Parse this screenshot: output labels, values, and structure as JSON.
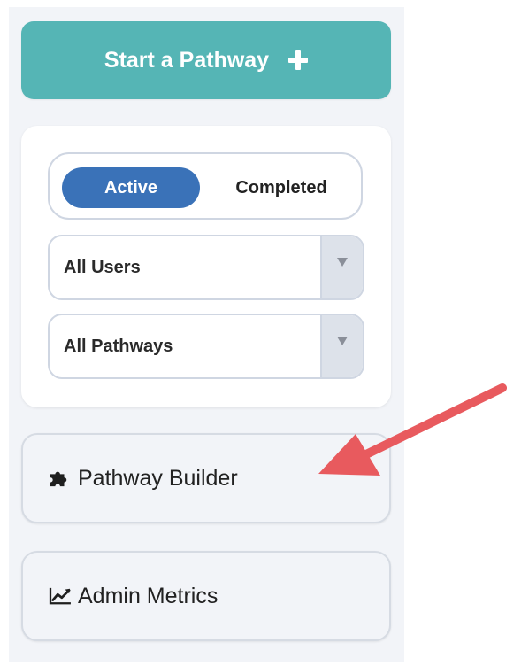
{
  "start_button": {
    "label": "Start a Pathway",
    "icon": "plus-icon"
  },
  "status_toggle": {
    "options": [
      "Active",
      "Completed"
    ],
    "selected": "Active"
  },
  "filters": {
    "users": {
      "value": "All Users"
    },
    "pathways": {
      "value": "All Pathways"
    }
  },
  "nav": {
    "pathway_builder": {
      "label": "Pathway Builder",
      "icon": "puzzle-piece-icon"
    },
    "admin_metrics": {
      "label": "Admin Metrics",
      "icon": "line-chart-icon"
    }
  },
  "annotation": {
    "type": "arrow",
    "color": "#e85a5e",
    "points_to": "Pathway Builder"
  },
  "colors": {
    "primary_teal": "#55b5b5",
    "active_blue": "#3a72b8",
    "panel_bg": "#f2f4f8"
  }
}
